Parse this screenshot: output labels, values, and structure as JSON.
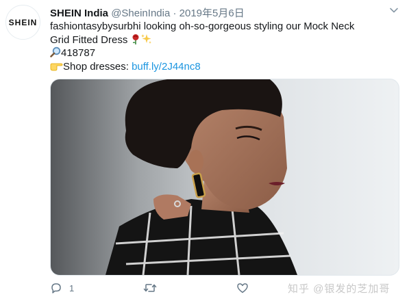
{
  "tweet": {
    "avatar_text": "SHEIN",
    "display_name": "SHEIN India",
    "handle": "@SheinIndia",
    "separator": "·",
    "date": "2019年5月6日",
    "line1": "fashiontasybysurbhi looking oh-so-gorgeous styling our Mock Neck",
    "line2_text": "Grid Fitted Dress ",
    "line3_text": "418787",
    "line4_text": "Shop dresses: ",
    "link": "buff.ly/2J44nc8"
  },
  "actions": {
    "reply_count": "1",
    "retweet_count": "",
    "like_count": ""
  },
  "watermark": "知乎 @银发的芝加哥",
  "colors": {
    "link": "#1b95e0",
    "meta": "#657786"
  }
}
